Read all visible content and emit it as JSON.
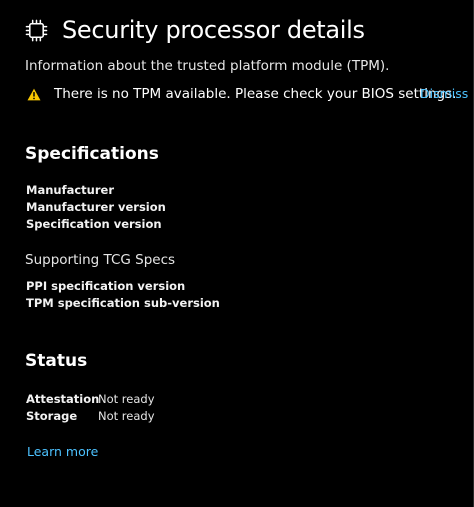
{
  "header": {
    "icon": "chip-icon",
    "title": "Security processor details",
    "subtitle": "Information about the trusted platform module (TPM)."
  },
  "warning": {
    "icon": "warning-icon",
    "icon_color": "#f7c600",
    "message": "There is no TPM available. Please check your BIOS settings.",
    "dismiss_label": "Dismiss"
  },
  "specifications": {
    "heading": "Specifications",
    "fields": [
      {
        "label": "Manufacturer"
      },
      {
        "label": "Manufacturer version"
      },
      {
        "label": "Specification version"
      }
    ],
    "tcg": {
      "heading": "Supporting TCG Specs",
      "fields": [
        {
          "label": "PPI specification version"
        },
        {
          "label": "TPM specification sub-version"
        }
      ]
    }
  },
  "status": {
    "heading": "Status",
    "rows": [
      {
        "label": "Attestation",
        "value": "Not ready"
      },
      {
        "label": "Storage",
        "value": "Not ready"
      }
    ]
  },
  "footer": {
    "learn_more_label": "Learn more"
  },
  "colors": {
    "background": "#000000",
    "text": "#ffffff",
    "link": "#4cc2ff",
    "warning": "#f7c600"
  }
}
